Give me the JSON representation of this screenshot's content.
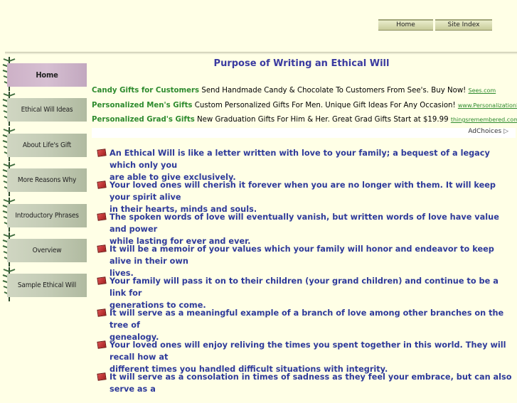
{
  "topnav": {
    "home": "Home",
    "site_index": "Site Index"
  },
  "sidebar": {
    "items": [
      {
        "label": "Home",
        "active": true
      },
      {
        "label": "Ethical Will Ideas"
      },
      {
        "label": "About Life's Gift"
      },
      {
        "label": "More Reasons Why"
      },
      {
        "label": "Introductory Phrases"
      },
      {
        "label": "Overview"
      },
      {
        "label": "Sample Ethical Will"
      }
    ]
  },
  "main": {
    "title": "Purpose of Writing an Ethical Will",
    "ads": [
      {
        "headline": "Candy Gifts for Customers",
        "text": "Send Handmade Candy & Chocolate To Customers From See's. Buy Now!",
        "url": "Sees.com"
      },
      {
        "headline": "Personalized Men's Gifts",
        "text": "Custom Personalized Gifts For Men. Unique Gift Ideas For Any Occasion!",
        "url": "www.PersonalizationMall.co"
      },
      {
        "headline": "Personalized Grad's Gifts",
        "text": "New Graduation Gifts For Him & Her. Great Grad Gifts Start at $19.99",
        "url": "thingsremembered.com/Graduat"
      }
    ],
    "adchoices": "AdChoices",
    "points": [
      "An Ethical Will is like a letter written with love to your family; a bequest of a legacy which only you\nare able to give exclusively.",
      "Your loved ones will cherish it forever when you are no longer with them. It will keep your spirit alive\nin their hearts, minds and souls.",
      "The spoken words of love will eventually vanish, but written words of love have value and power\nwhile lasting for ever and ever.",
      "It will be a memoir of your values which your family will honor and endeavor to keep alive in their own\nlives.",
      "Your family will pass it on to their children (your grand children) and continue to be a link for\ngenerations to come.",
      "It will serve as a meaningful example of a branch of love among other branches on the tree of\ngenealogy.",
      "Your loved ones will enjoy reliving the times you spent together in this world. They will recall how at\ndifferent times you handled difficult situations with integrity.",
      "It will serve as a consolation in times of sadness as they feel your embrace, but can also serve as a"
    ]
  },
  "colors": {
    "background": "#ffffe6",
    "title": "#3a3aa0",
    "body_text": "#2e3a9a",
    "ad_headline": "#2e8b2e"
  }
}
